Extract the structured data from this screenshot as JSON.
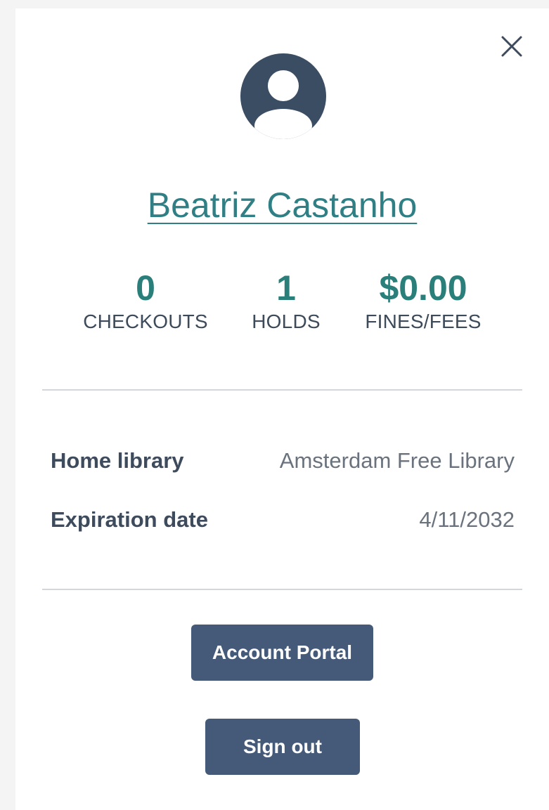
{
  "icons": {
    "close": "close-icon",
    "avatar": "user-avatar-icon"
  },
  "colors": {
    "accent_teal": "#2a7f7a",
    "button_bg": "#455a78",
    "text_dark": "#3d4b5d"
  },
  "user": {
    "name": "Beatriz Castanho"
  },
  "stats": [
    {
      "value": "0",
      "label": "CHECKOUTS"
    },
    {
      "value": "1",
      "label": "HOLDS"
    },
    {
      "value": "$0.00",
      "label": "FINES/FEES"
    }
  ],
  "info": [
    {
      "label": "Home library",
      "value": "Amsterdam Free Library"
    },
    {
      "label": "Expiration date",
      "value": "4/11/2032"
    }
  ],
  "buttons": {
    "account_portal": "Account Portal",
    "sign_out": "Sign out"
  }
}
